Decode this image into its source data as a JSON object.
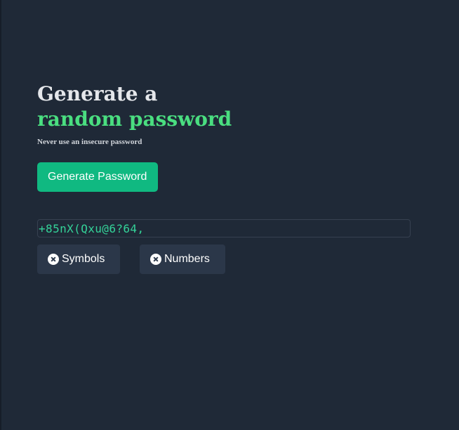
{
  "heading": {
    "line1": "Generate a",
    "line2": "random password"
  },
  "subtitle": "Never use an insecure password",
  "generate_button": {
    "label": "Generate Password"
  },
  "password_output": {
    "value": "+85nX(Qxu@6?64,"
  },
  "options": [
    {
      "label": "Symbols",
      "icon": "x-circle-icon",
      "enabled": false
    },
    {
      "label": "Numbers",
      "icon": "x-circle-icon",
      "enabled": false
    }
  ],
  "colors": {
    "background": "#1f2937",
    "accent_green": "#4ade80",
    "button_green": "#10b981",
    "password_text": "#34d399",
    "toggle_bg": "#2b3749"
  }
}
